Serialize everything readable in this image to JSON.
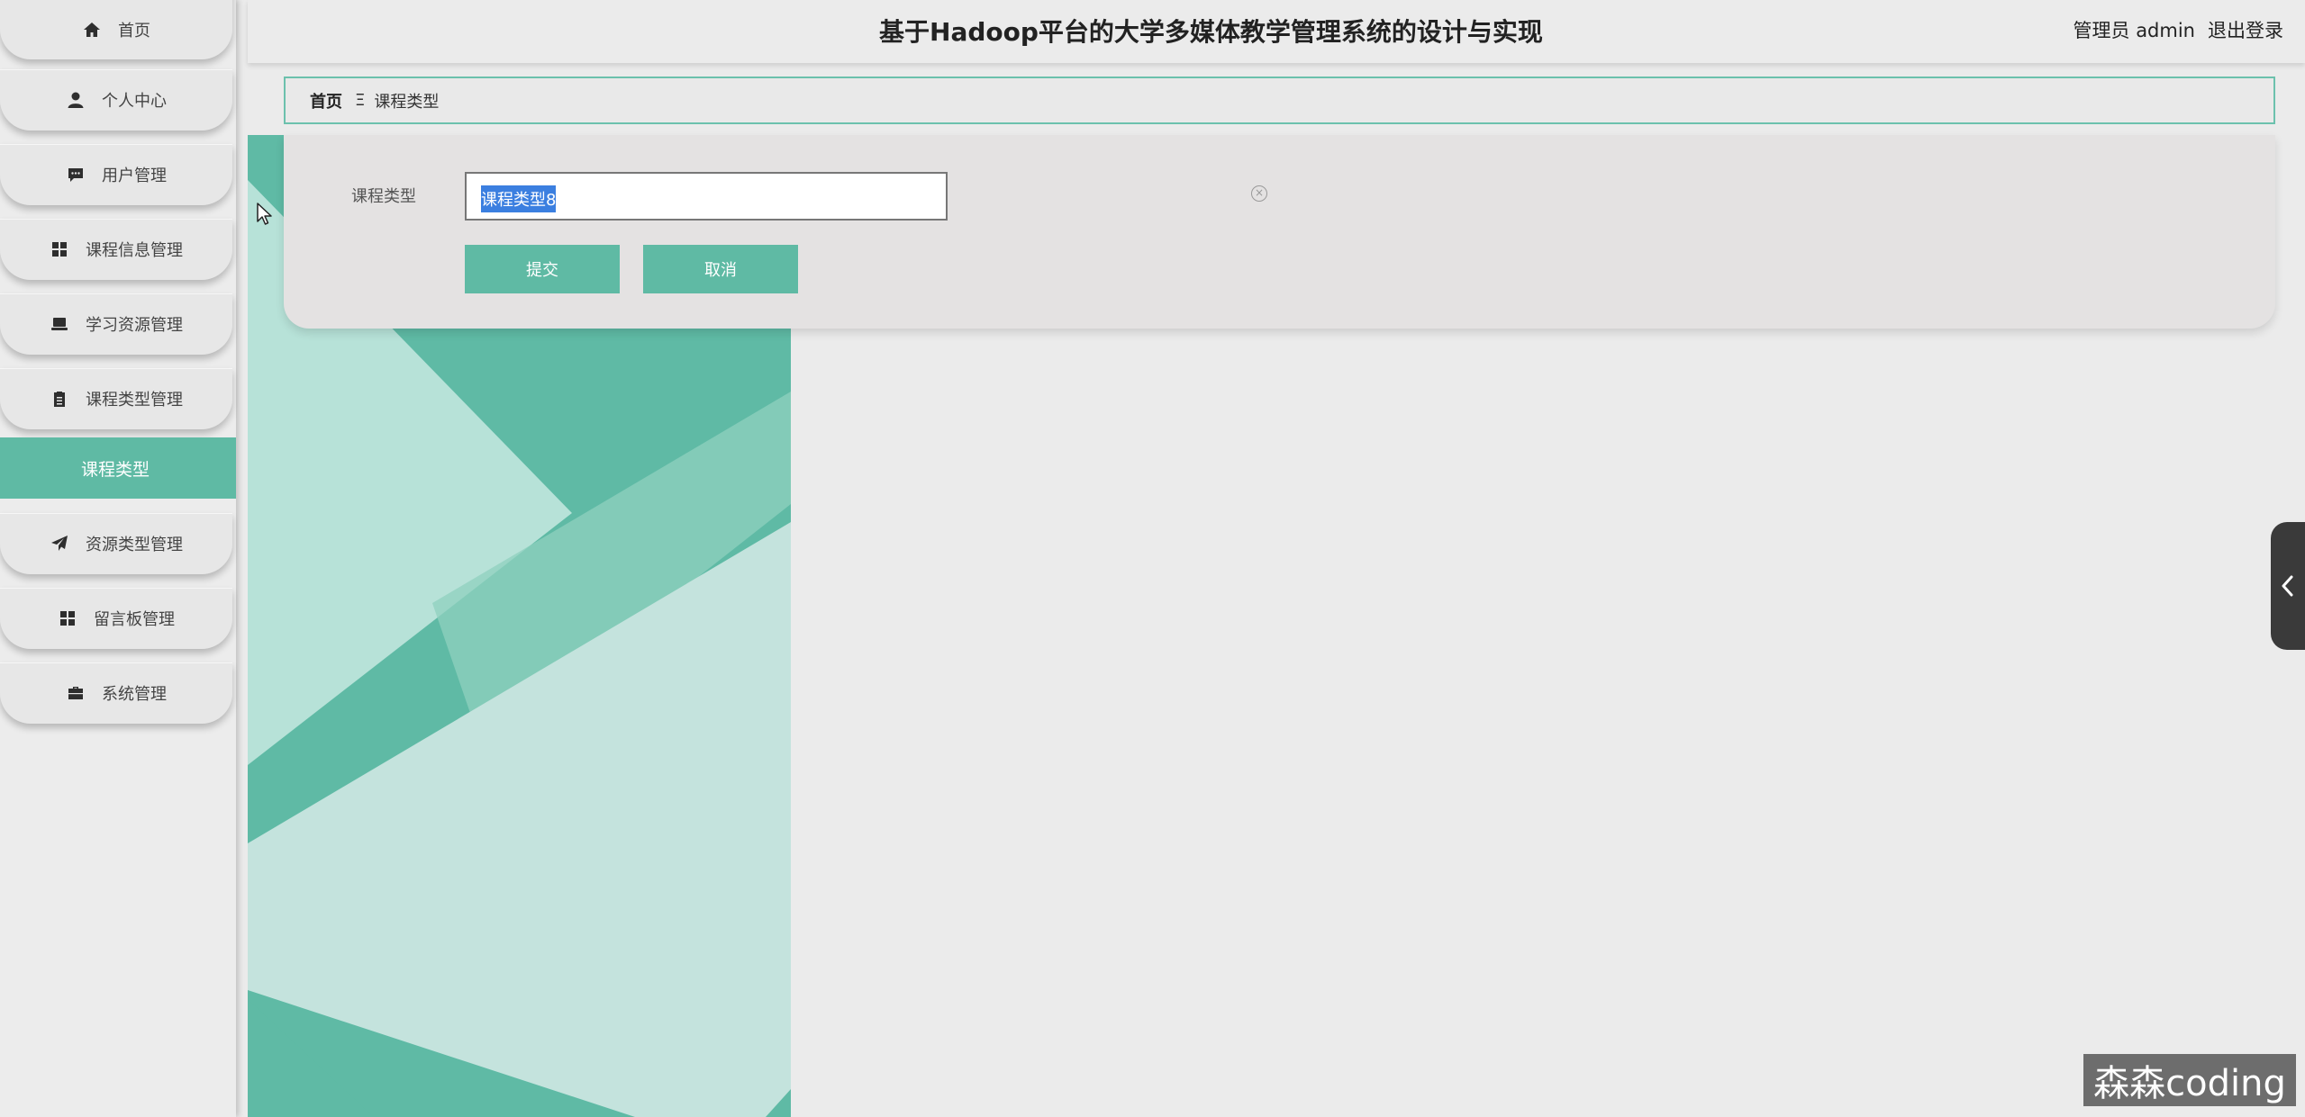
{
  "header": {
    "title": "基于Hadoop平台的大学多媒体教学管理系统的设计与实现",
    "user_label": "管理员 admin",
    "logout_label": "退出登录"
  },
  "sidebar": {
    "items": [
      {
        "label": "首页",
        "icon": "home-icon"
      },
      {
        "label": "个人中心",
        "icon": "user-icon"
      },
      {
        "label": "用户管理",
        "icon": "comment-icon"
      },
      {
        "label": "课程信息管理",
        "icon": "grid-icon"
      },
      {
        "label": "学习资源管理",
        "icon": "laptop-icon"
      },
      {
        "label": "课程类型管理",
        "icon": "clipboard-icon"
      },
      {
        "label": "资源类型管理",
        "icon": "paper-plane-icon"
      },
      {
        "label": "留言板管理",
        "icon": "grid-icon"
      },
      {
        "label": "系统管理",
        "icon": "briefcase-icon"
      }
    ],
    "active_sub_item": "课程类型"
  },
  "breadcrumb": {
    "home": "首页",
    "separator": "Ξ",
    "current": "课程类型"
  },
  "form": {
    "field_label": "课程类型",
    "field_value": "课程类型8",
    "submit_label": "提交",
    "cancel_label": "取消"
  },
  "watermark": "森森coding",
  "colors": {
    "accent": "#5fbaa4",
    "accent_border": "#6cc1ad",
    "selection": "#3b7fe0",
    "background": "#ebebeb"
  }
}
